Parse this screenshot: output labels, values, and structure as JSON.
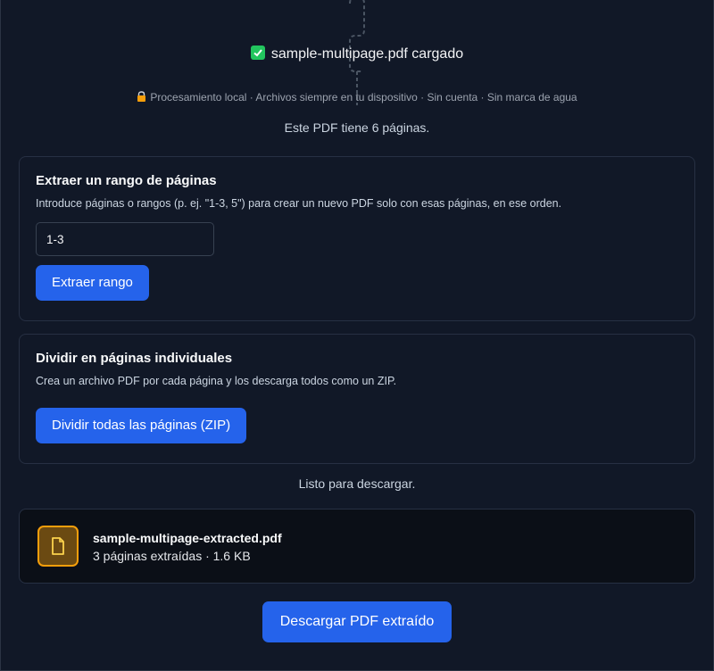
{
  "upload": {
    "check_icon": "check-box-icon",
    "filename_loaded": "sample-multipage.pdf cargado"
  },
  "privacy": {
    "lock_icon": "lock-icon",
    "text": "Procesamiento local · Archivos siempre en tu dispositivo · Sin cuenta · Sin marca de agua"
  },
  "pages_info": "Este PDF tiene 6 páginas.",
  "extract": {
    "title": "Extraer un rango de páginas",
    "description": "Introduce páginas o rangos (p. ej. \"1-3, 5\") para crear un nuevo PDF solo con esas páginas, en ese orden.",
    "input_value": "1-3",
    "button_label": "Extraer rango"
  },
  "split": {
    "title": "Dividir en páginas individuales",
    "description": "Crea un archivo PDF por cada página y los descarga todos como un ZIP.",
    "button_label": "Dividir todas las páginas (ZIP)"
  },
  "status": "Listo para descargar.",
  "result": {
    "file_icon": "file-icon",
    "filename": "sample-multipage-extracted.pdf",
    "meta": "3 páginas extraídas · 1.6 KB"
  },
  "download_label": "Descargar PDF extraído",
  "colors": {
    "background": "#111827",
    "accent": "#2563eb",
    "success": "#22c55e",
    "file_icon": "#f59e0b"
  }
}
